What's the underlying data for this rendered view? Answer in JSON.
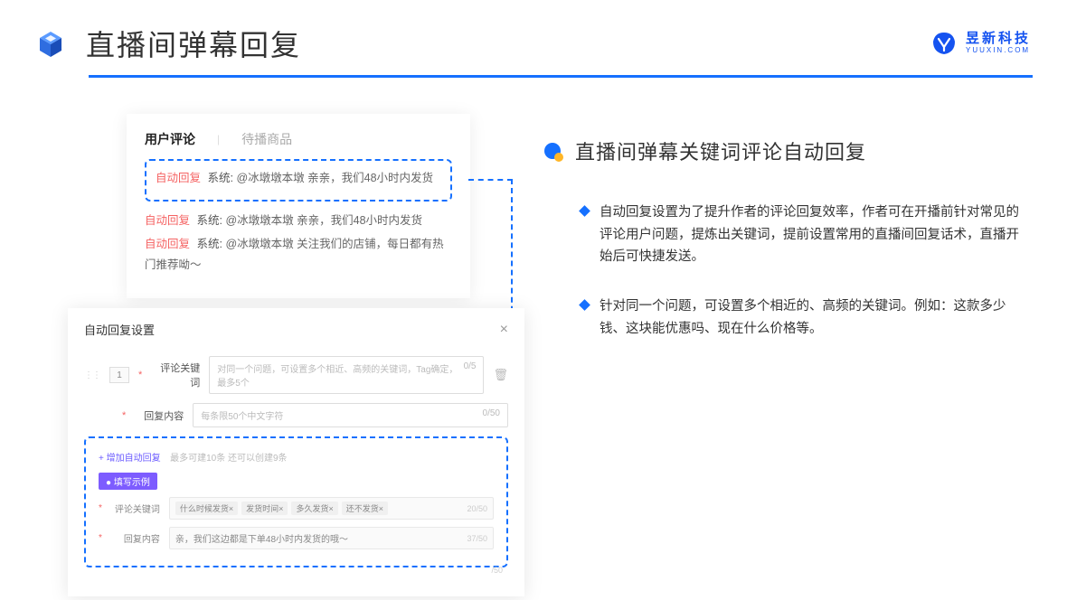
{
  "header": {
    "title": "直播间弹幕回复"
  },
  "brand": {
    "cn": "昱新科技",
    "en": "YUUXIN.COM"
  },
  "card1": {
    "tab1": "用户评论",
    "tab2": "待播商品",
    "c1": {
      "tag": "自动回复",
      "sys": "系统:",
      "txt": "@冰墩墩本墩 亲亲，我们48小时内发货"
    },
    "c2": {
      "tag": "自动回复",
      "sys": "系统:",
      "txt": "@冰墩墩本墩 亲亲，我们48小时内发货"
    },
    "c3": {
      "tag": "自动回复",
      "sys": "系统:",
      "txt": "@冰墩墩本墩 关注我们的店铺，每日都有热门推荐呦～"
    }
  },
  "card2": {
    "title": "自动回复设置",
    "idx": "1",
    "row1": {
      "label": "评论关键词",
      "ph": "对同一个问题，可设置多个相近、高频的关键词，Tag确定，最多5个",
      "cnt": "0/5"
    },
    "row2": {
      "label": "回复内容",
      "ph": "每条限50个中文字符",
      "cnt": "0/50"
    },
    "add": "+ 增加自动回复",
    "hint": "最多可建10条 还可以创建9条",
    "badge": "● 填写示例",
    "ex1": {
      "label": "评论关键词",
      "t1": "什么时候发货×",
      "t2": "发货时间×",
      "t3": "多久发货×",
      "t4": "还不发货×",
      "cnt": "20/50"
    },
    "ex2": {
      "label": "回复内容",
      "txt": "亲，我们这边都是下单48小时内发货的哦～",
      "cnt": "37/50"
    },
    "outer_cnt": "/50"
  },
  "right": {
    "title": "直播间弹幕关键词评论自动回复",
    "b1": "自动回复设置为了提升作者的评论回复效率，作者可在开播前针对常见的评论用户问题，提炼出关键词，提前设置常用的直播间回复话术，直播开始后可快捷发送。",
    "b2": "针对同一个问题，可设置多个相近的、高频的关键词。例如：这款多少钱、这块能优惠吗、现在什么价格等。"
  }
}
